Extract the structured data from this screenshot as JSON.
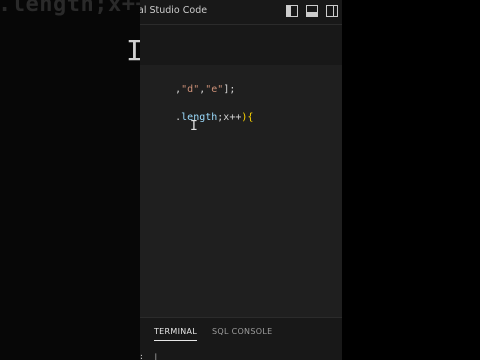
{
  "background": {
    "code_fragment": ".length;x++",
    "cursor_glyph": "I"
  },
  "window": {
    "title": "al Studio Code",
    "layout_icons": [
      "toggle-primary-sidebar-icon",
      "toggle-panel-icon",
      "toggle-secondary-sidebar-icon"
    ]
  },
  "editor": {
    "line1": {
      "t1": ",",
      "s1": "\"d\"",
      "t2": ",",
      "s2": "\"e\"",
      "t3": "];"
    },
    "line2": {
      "t1": ".",
      "prop": "length",
      "t2": ";x++",
      "p1": "){"
    },
    "cursor_glyph": "I"
  },
  "panel": {
    "tabs": [
      {
        "label": "TERMINAL",
        "active": true
      },
      {
        "label": "SQL CONSOLE",
        "active": false
      }
    ],
    "prompt_text": ":  ❘"
  },
  "colors": {
    "title_bar": "#181818",
    "editor_bg": "#1f1f1f",
    "string": "#ce9178",
    "property": "#9cdcfe",
    "bracket": "#ffd700"
  }
}
